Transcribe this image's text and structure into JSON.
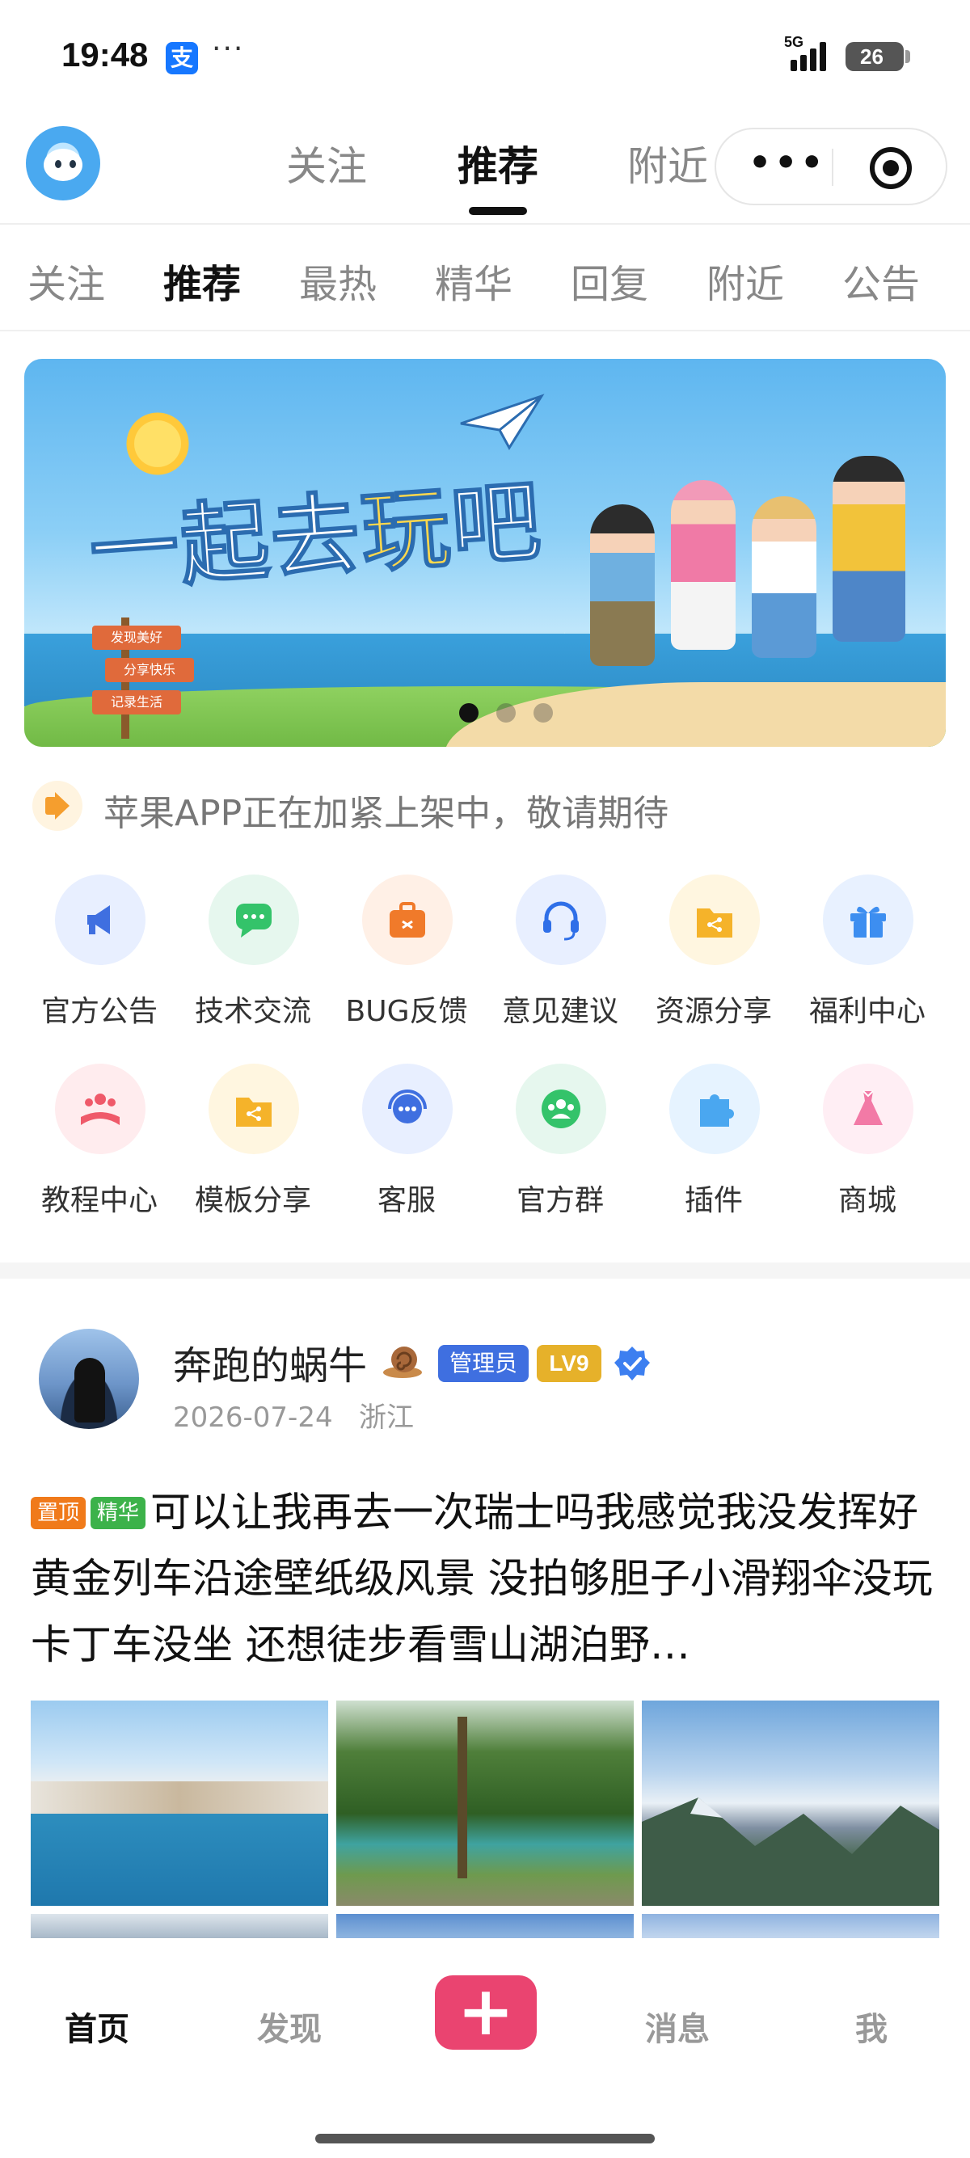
{
  "status_bar": {
    "time": "19:48",
    "alipay_icon_text": "支",
    "more_dots": "···",
    "network": "5G",
    "battery": "26"
  },
  "header": {
    "tabs": [
      {
        "label": "关注",
        "active": false
      },
      {
        "label": "推荐",
        "active": true
      },
      {
        "label": "附近",
        "active": false
      }
    ],
    "capsule_more": "•••",
    "capsule_icon": "target-icon"
  },
  "sub_tabs": [
    {
      "label": "关注",
      "active": false
    },
    {
      "label": "推荐",
      "active": true
    },
    {
      "label": "最热",
      "active": false
    },
    {
      "label": "精华",
      "active": false
    },
    {
      "label": "回复",
      "active": false
    },
    {
      "label": "附近",
      "active": false
    },
    {
      "label": "公告",
      "active": false
    }
  ],
  "banner": {
    "title_part1": "一起去",
    "title_highlight": "玩",
    "title_part2": "吧",
    "signs": [
      "发现美好",
      "分享快乐",
      "记录生活"
    ],
    "slide_count": 3,
    "active_slide": 1
  },
  "notice": {
    "icon": "megaphone-icon",
    "text": "苹果APP正在加紧上架中，敬请期待"
  },
  "quick_links": [
    {
      "label": "官方公告",
      "icon": "megaphone-icon",
      "bg": "#e8efff",
      "color": "#3f6fe0"
    },
    {
      "label": "技术交流",
      "icon": "chat-icon",
      "bg": "#e6f7ee",
      "color": "#34c36a"
    },
    {
      "label": "BUG反馈",
      "icon": "briefcase-icon",
      "bg": "#fff0e6",
      "color": "#f07a2a"
    },
    {
      "label": "意见建议",
      "icon": "headset-icon",
      "bg": "#e8efff",
      "color": "#2f6fe8"
    },
    {
      "label": "资源分享",
      "icon": "folder-share-icon",
      "bg": "#fff6e0",
      "color": "#f5b32a"
    },
    {
      "label": "福利中心",
      "icon": "gift-icon",
      "bg": "#e8f1ff",
      "color": "#3d8ef0"
    },
    {
      "label": "教程中心",
      "icon": "group-book-icon",
      "bg": "#ffecee",
      "color": "#ef5a6a"
    },
    {
      "label": "模板分享",
      "icon": "folder-share-icon",
      "bg": "#fff6e0",
      "color": "#f5b32a"
    },
    {
      "label": "客服",
      "icon": "support-chat-icon",
      "bg": "#e8efff",
      "color": "#3f6fe0"
    },
    {
      "label": "官方群",
      "icon": "group-icon",
      "bg": "#e6f7ee",
      "color": "#34c36a"
    },
    {
      "label": "插件",
      "icon": "puzzle-icon",
      "bg": "#e6f3ff",
      "color": "#4aa7f0"
    },
    {
      "label": "商城",
      "icon": "dress-icon",
      "bg": "#ffeef4",
      "color": "#f27aa6"
    }
  ],
  "post": {
    "author": "奔跑的蜗牛",
    "author_emoji": "snail-icon",
    "role_badge": "管理员",
    "level_badge": "LV9",
    "verified_icon": "verified-icon",
    "date": "2026-07-24",
    "location": "浙江",
    "tag_top": "置顶",
    "tag_featured": "精华",
    "text": "可以让我再去一次瑞士吗我感觉我没发挥好黄金列车沿途壁纸级风景 没拍够胆子小滑翔伞没玩卡丁车没坐 还想徒步看雪山湖泊野…",
    "photo_count": 6
  },
  "tabbar": {
    "items": [
      {
        "label": "首页",
        "active": true
      },
      {
        "label": "发现",
        "active": false
      },
      {
        "label": "消息",
        "active": false
      },
      {
        "label": "我",
        "active": false
      }
    ],
    "add_button": "+"
  },
  "colors": {
    "accent": "#ea4470",
    "admin_badge": "#3f6fe0",
    "level_badge": "#e6b12a",
    "tag_top": "#f07a1a",
    "tag_featured": "#3cb24a"
  }
}
